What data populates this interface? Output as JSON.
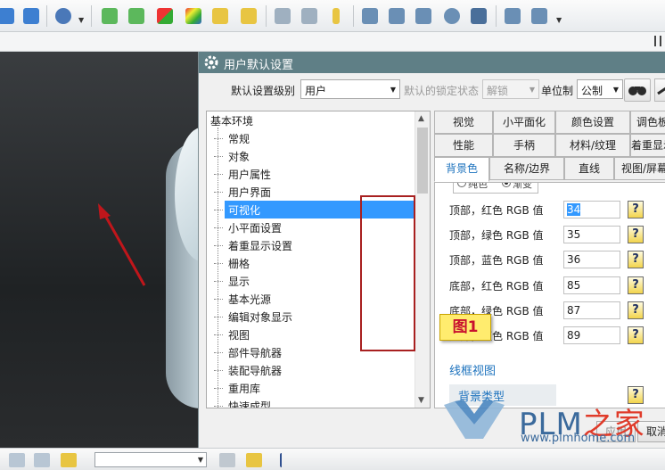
{
  "toolbar": {
    "icons": [
      "layout-icon",
      "layout-icon",
      "gear-icon",
      "import-up-icon",
      "export-down-icon",
      "color-red-icon",
      "color-multi-icon",
      "box-icon",
      "box-new-icon",
      "abc-label-icon",
      "abc-label-icon",
      "cylinder-icon",
      "surface-icon",
      "mesh-icon",
      "grid-icon",
      "point-icon",
      "name-icon",
      "wand-icon",
      "folder-icon"
    ]
  },
  "viewport": {
    "bg": "#2b2e30"
  },
  "dialog": {
    "title": "用户默认设置",
    "level_label": "默认设置级别",
    "level_value": "用户",
    "lock_label": "默认的锁定状态",
    "lock_value": "解锁",
    "unit_label": "单位制",
    "unit_value": "公制",
    "tree": {
      "root": "基本环境",
      "items": [
        "常规",
        "对象",
        "用户属性",
        "用户界面",
        "可视化",
        "小平面设置",
        "着重显示设置",
        "栅格",
        "显示",
        "基本光源",
        "编辑对象显示",
        "视图",
        "部件导航器",
        "装配导航器",
        "重用库",
        "快速成型"
      ],
      "selected_index": 4
    },
    "figure_label": "图1",
    "tabs": {
      "row1": [
        "视觉",
        "小平面化",
        "颜色设置",
        "调色板"
      ],
      "row2": [
        "性能",
        "手柄",
        "材料/纹理",
        "着重显示"
      ],
      "row3": [
        "背景色",
        "名称/边界",
        "直线",
        "视图/屏幕"
      ],
      "active": "背景色"
    },
    "radio": {
      "opt1": "纯色",
      "opt2": "渐变"
    },
    "params": [
      {
        "label": "顶部，红色 RGB 值",
        "value": "34"
      },
      {
        "label": "顶部，绿色 RGB 值",
        "value": "35"
      },
      {
        "label": "顶部，蓝色 RGB 值",
        "value": "36"
      },
      {
        "label": "底部，红色 RGB 值",
        "value": "85"
      },
      {
        "label": "底部，绿色 RGB 值",
        "value": "87"
      },
      {
        "label": "底部，蓝色 RGB 值",
        "value": "89"
      }
    ],
    "help_glyph": "?",
    "section_wireframe": "线框视图",
    "bg_type_label": "背景类型",
    "btn_apply": "应用",
    "btn_cancel": "取消"
  },
  "watermark": {
    "brand": "PLM",
    "brand_cn": "之家",
    "url": "www.plmhome.com"
  },
  "colors": {
    "accent": "#3399ff",
    "title_bar": "#5f7f86",
    "highlight_box": "#a82020",
    "figure_note": "#ffec6e"
  }
}
